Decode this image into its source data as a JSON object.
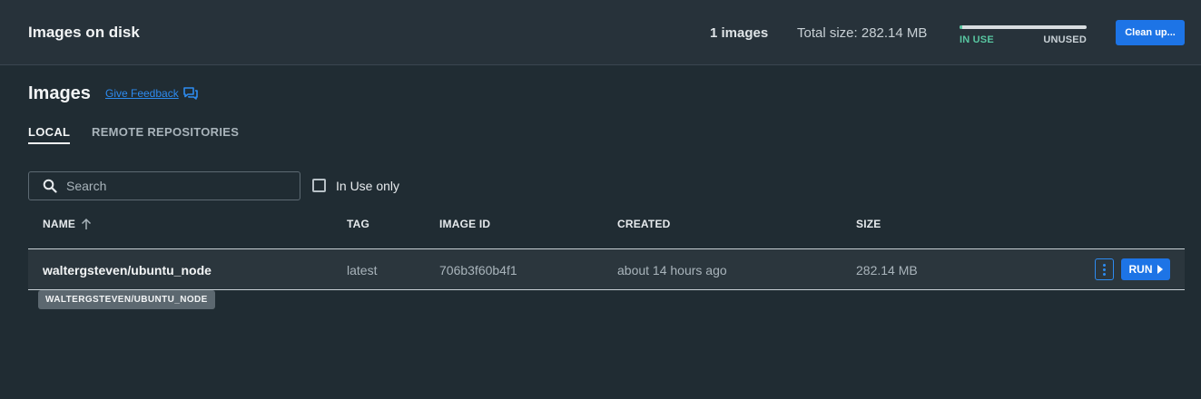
{
  "header": {
    "title": "Images on disk",
    "image_count": "1 images",
    "total_size": "Total size: 282.14 MB",
    "usage": {
      "in_use_label": "IN USE",
      "unused_label": "UNUSED",
      "in_use_fraction": 0.02
    },
    "cleanup_label": "Clean up..."
  },
  "page": {
    "title": "Images",
    "feedback_label": "Give Feedback"
  },
  "tabs": [
    {
      "label": "LOCAL",
      "active": true
    },
    {
      "label": "REMOTE REPOSITORIES",
      "active": false
    }
  ],
  "search": {
    "placeholder": "Search",
    "value": ""
  },
  "filter": {
    "in_use_only_label": "In Use only",
    "checked": false
  },
  "table": {
    "columns": {
      "name": "NAME",
      "tag": "TAG",
      "image_id": "IMAGE ID",
      "created": "CREATED",
      "size": "SIZE"
    },
    "rows": [
      {
        "name": "waltergsteven/ubuntu_node",
        "tag": "latest",
        "image_id": "706b3f60b4f1",
        "created": "about 14 hours ago",
        "size": "282.14 MB",
        "run_label": "RUN"
      }
    ]
  },
  "tooltip": {
    "text": "WALTERGSTEVEN/UBUNTU_NODE"
  },
  "colors": {
    "accent": "#1d74e6",
    "in_use": "#58c5a0",
    "background": "#202c33",
    "header_bg": "#27323a"
  }
}
